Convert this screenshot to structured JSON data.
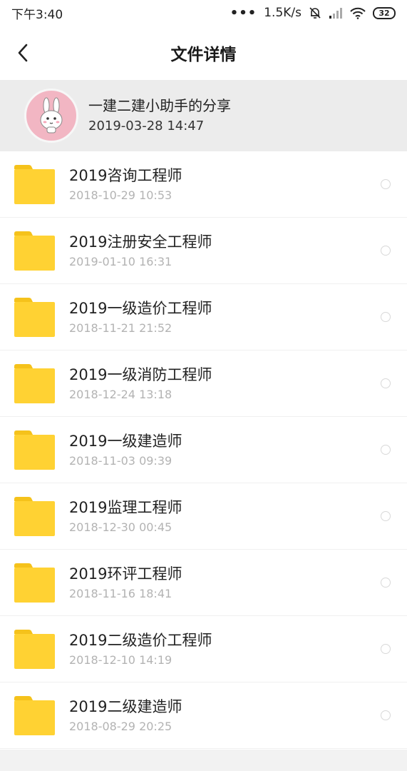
{
  "status_bar": {
    "time": "下午3:40",
    "more": "•••",
    "net_speed": "1.5K/s",
    "battery": "32",
    "icons": [
      "mute-bell-icon",
      "signal-icon",
      "wifi-icon",
      "battery-icon"
    ]
  },
  "nav": {
    "back_icon": "chevron-left-icon",
    "title": "文件详情"
  },
  "share": {
    "title": "一建二建小助手的分享",
    "date": "2019-03-28  14:47",
    "avatar_icon": "bunny-avatar-icon",
    "avatar_color": "#f2b6c3",
    "background": "#ececec"
  },
  "files": [
    {
      "name": "2019咨询工程师",
      "time": "2018-10-29  10:53"
    },
    {
      "name": "2019注册安全工程师",
      "time": "2019-01-10  16:31"
    },
    {
      "name": "2019一级造价工程师",
      "time": "2018-11-21  21:52"
    },
    {
      "name": "2019一级消防工程师",
      "time": "2018-12-24  13:18"
    },
    {
      "name": "2019一级建造师",
      "time": "2018-11-03  09:39"
    },
    {
      "name": "2019监理工程师",
      "time": "2018-12-30  00:45"
    },
    {
      "name": "2019环评工程师",
      "time": "2018-11-16  18:41"
    },
    {
      "name": "2019二级造价工程师",
      "time": "2018-12-10  14:19"
    },
    {
      "name": "2019二级建造师",
      "time": "2018-08-29  20:25"
    }
  ],
  "colors": {
    "folder": "#ffd233",
    "folder_tab": "#f5c21b",
    "time_text": "#b3b3b3"
  }
}
